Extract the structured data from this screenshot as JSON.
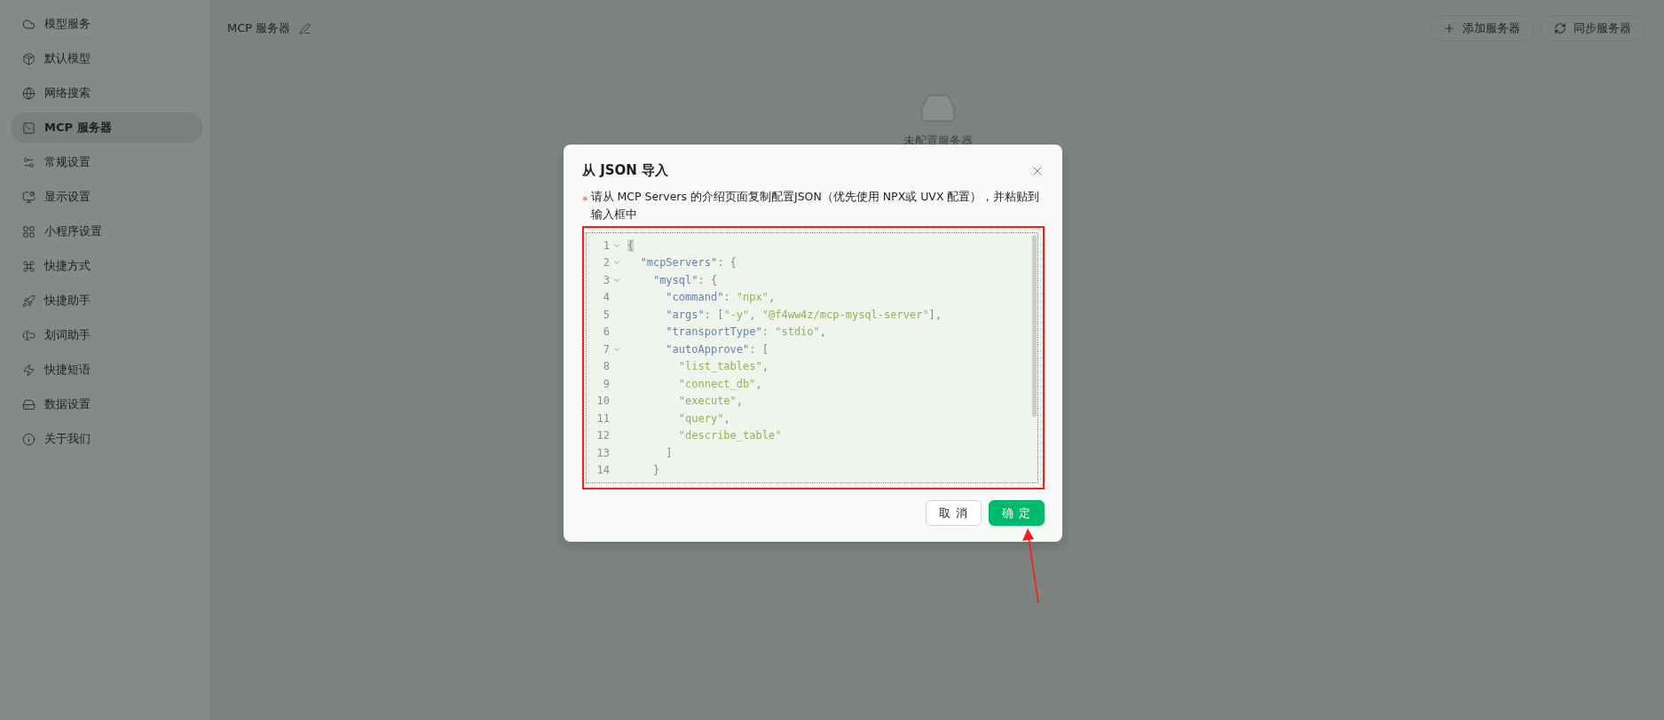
{
  "sidebar": {
    "items": [
      {
        "label": "模型服务",
        "selected": false
      },
      {
        "label": "默认模型",
        "selected": false
      },
      {
        "label": "网络搜索",
        "selected": false
      },
      {
        "label": "MCP 服务器",
        "selected": true
      },
      {
        "label": "常规设置",
        "selected": false
      },
      {
        "label": "显示设置",
        "selected": false
      },
      {
        "label": "小程序设置",
        "selected": false
      },
      {
        "label": "快捷方式",
        "selected": false
      },
      {
        "label": "快捷助手",
        "selected": false
      },
      {
        "label": "划词助手",
        "selected": false
      },
      {
        "label": "快捷短语",
        "selected": false
      },
      {
        "label": "数据设置",
        "selected": false
      },
      {
        "label": "关于我们",
        "selected": false
      }
    ]
  },
  "header": {
    "title": "MCP 服务器",
    "buttons": [
      {
        "label": "添加服务器"
      },
      {
        "label": "同步服务器"
      }
    ]
  },
  "empty_state": {
    "text": "未配置服务器"
  },
  "dialog": {
    "title": "从 JSON 导入",
    "required_mark": "*",
    "instruction": "请从 MCP Servers 的介绍页面复制配置JSON（优先使用 NPX或 UVX 配置），并粘贴到输入框中",
    "editor": {
      "lines": [
        {
          "number": "1",
          "foldable": true,
          "matched": true,
          "text": "{"
        },
        {
          "number": "2",
          "foldable": true,
          "matched": false,
          "text": "  \"mcpServers\": {"
        },
        {
          "number": "3",
          "foldable": true,
          "matched": false,
          "text": "    \"mysql\": {"
        },
        {
          "number": "4",
          "foldable": false,
          "matched": false,
          "text": "      \"command\": \"npx\","
        },
        {
          "number": "5",
          "foldable": false,
          "matched": false,
          "text": "      \"args\": [\"-y\", \"@f4ww4z/mcp-mysql-server\"],"
        },
        {
          "number": "6",
          "foldable": false,
          "matched": false,
          "text": "      \"transportType\": \"stdio\","
        },
        {
          "number": "7",
          "foldable": true,
          "matched": false,
          "text": "      \"autoApprove\": ["
        },
        {
          "number": "8",
          "foldable": false,
          "matched": false,
          "text": "        \"list_tables\","
        },
        {
          "number": "9",
          "foldable": false,
          "matched": false,
          "text": "        \"connect_db\","
        },
        {
          "number": "10",
          "foldable": false,
          "matched": false,
          "text": "        \"execute\","
        },
        {
          "number": "11",
          "foldable": false,
          "matched": false,
          "text": "        \"query\","
        },
        {
          "number": "12",
          "foldable": false,
          "matched": false,
          "text": "        \"describe_table\""
        },
        {
          "number": "13",
          "foldable": false,
          "matched": false,
          "text": "      ]"
        },
        {
          "number": "14",
          "foldable": false,
          "matched": false,
          "text": "    }"
        }
      ]
    },
    "buttons": [
      {
        "label": "取 消",
        "kind": "default"
      },
      {
        "label": "确 定",
        "kind": "primary"
      }
    ]
  }
}
